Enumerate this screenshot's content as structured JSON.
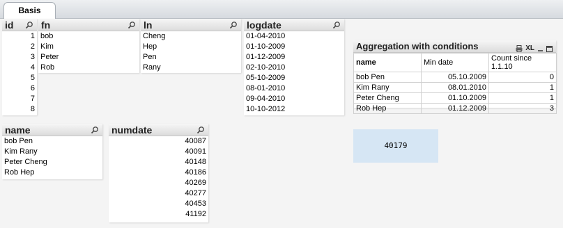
{
  "tab": {
    "label": "Basis"
  },
  "lists": {
    "id": {
      "title": "id",
      "values": [
        "1",
        "2",
        "3",
        "4",
        "5",
        "6",
        "7",
        "8"
      ]
    },
    "fn": {
      "title": "fn",
      "values": [
        "bob",
        "Kim",
        "Peter",
        "Rob"
      ]
    },
    "ln": {
      "title": "ln",
      "values": [
        "Cheng",
        "Hep",
        "Pen",
        "Rany"
      ]
    },
    "logdate": {
      "title": "logdate",
      "values": [
        "01-04-2010",
        "01-10-2009",
        "01-12-2009",
        "02-10-2010",
        "05-10-2009",
        "08-01-2010",
        "09-04-2010",
        "10-10-2012"
      ]
    },
    "name": {
      "title": "name",
      "values": [
        "bob Pen",
        "Kim Rany",
        "Peter Cheng",
        "Rob Hep"
      ]
    },
    "numdate": {
      "title": "numdate",
      "values": [
        "40087",
        "40091",
        "40148",
        "40186",
        "40269",
        "40277",
        "40453",
        "41192"
      ]
    }
  },
  "aggregation": {
    "title": "Aggregation with conditions",
    "xl_label": "XL",
    "headers": [
      "name",
      "Min date",
      "Count since 1.1.10"
    ],
    "rows": [
      [
        "bob Pen",
        "05.10.2009",
        "0"
      ],
      [
        "Kim Rany",
        "08.01.2010",
        "1"
      ],
      [
        "Peter Cheng",
        "01.10.2009",
        "1"
      ],
      [
        "Rob Hep",
        "01.12.2009",
        "3"
      ]
    ]
  },
  "kpi": {
    "value": "40179"
  },
  "colors": {
    "kpi_bg": "#d6e6f4",
    "caption_bg": "#dcdcdc"
  }
}
